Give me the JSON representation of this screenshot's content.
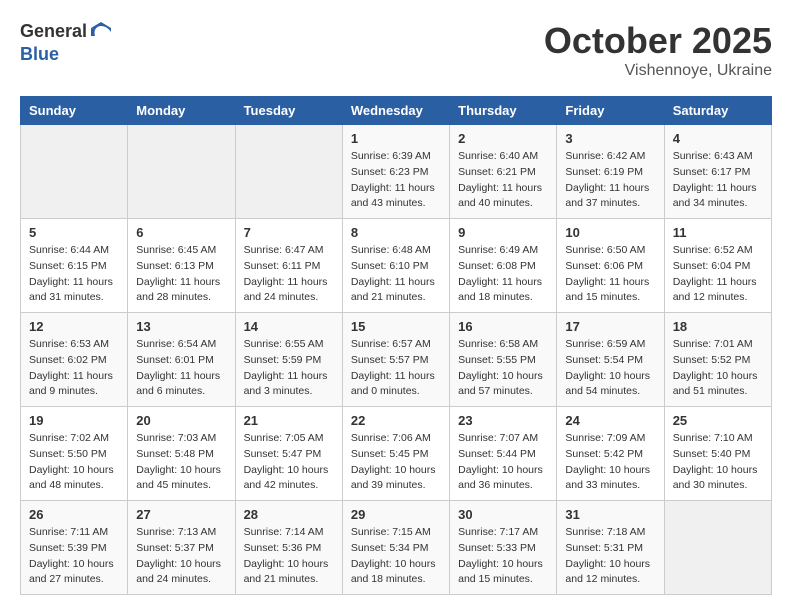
{
  "header": {
    "logo_general": "General",
    "logo_blue": "Blue",
    "month": "October 2025",
    "location": "Vishennoye, Ukraine"
  },
  "calendar": {
    "weekdays": [
      "Sunday",
      "Monday",
      "Tuesday",
      "Wednesday",
      "Thursday",
      "Friday",
      "Saturday"
    ],
    "weeks": [
      [
        {
          "day": "",
          "info": ""
        },
        {
          "day": "",
          "info": ""
        },
        {
          "day": "",
          "info": ""
        },
        {
          "day": "1",
          "info": "Sunrise: 6:39 AM\nSunset: 6:23 PM\nDaylight: 11 hours\nand 43 minutes."
        },
        {
          "day": "2",
          "info": "Sunrise: 6:40 AM\nSunset: 6:21 PM\nDaylight: 11 hours\nand 40 minutes."
        },
        {
          "day": "3",
          "info": "Sunrise: 6:42 AM\nSunset: 6:19 PM\nDaylight: 11 hours\nand 37 minutes."
        },
        {
          "day": "4",
          "info": "Sunrise: 6:43 AM\nSunset: 6:17 PM\nDaylight: 11 hours\nand 34 minutes."
        }
      ],
      [
        {
          "day": "5",
          "info": "Sunrise: 6:44 AM\nSunset: 6:15 PM\nDaylight: 11 hours\nand 31 minutes."
        },
        {
          "day": "6",
          "info": "Sunrise: 6:45 AM\nSunset: 6:13 PM\nDaylight: 11 hours\nand 28 minutes."
        },
        {
          "day": "7",
          "info": "Sunrise: 6:47 AM\nSunset: 6:11 PM\nDaylight: 11 hours\nand 24 minutes."
        },
        {
          "day": "8",
          "info": "Sunrise: 6:48 AM\nSunset: 6:10 PM\nDaylight: 11 hours\nand 21 minutes."
        },
        {
          "day": "9",
          "info": "Sunrise: 6:49 AM\nSunset: 6:08 PM\nDaylight: 11 hours\nand 18 minutes."
        },
        {
          "day": "10",
          "info": "Sunrise: 6:50 AM\nSunset: 6:06 PM\nDaylight: 11 hours\nand 15 minutes."
        },
        {
          "day": "11",
          "info": "Sunrise: 6:52 AM\nSunset: 6:04 PM\nDaylight: 11 hours\nand 12 minutes."
        }
      ],
      [
        {
          "day": "12",
          "info": "Sunrise: 6:53 AM\nSunset: 6:02 PM\nDaylight: 11 hours\nand 9 minutes."
        },
        {
          "day": "13",
          "info": "Sunrise: 6:54 AM\nSunset: 6:01 PM\nDaylight: 11 hours\nand 6 minutes."
        },
        {
          "day": "14",
          "info": "Sunrise: 6:55 AM\nSunset: 5:59 PM\nDaylight: 11 hours\nand 3 minutes."
        },
        {
          "day": "15",
          "info": "Sunrise: 6:57 AM\nSunset: 5:57 PM\nDaylight: 11 hours\nand 0 minutes."
        },
        {
          "day": "16",
          "info": "Sunrise: 6:58 AM\nSunset: 5:55 PM\nDaylight: 10 hours\nand 57 minutes."
        },
        {
          "day": "17",
          "info": "Sunrise: 6:59 AM\nSunset: 5:54 PM\nDaylight: 10 hours\nand 54 minutes."
        },
        {
          "day": "18",
          "info": "Sunrise: 7:01 AM\nSunset: 5:52 PM\nDaylight: 10 hours\nand 51 minutes."
        }
      ],
      [
        {
          "day": "19",
          "info": "Sunrise: 7:02 AM\nSunset: 5:50 PM\nDaylight: 10 hours\nand 48 minutes."
        },
        {
          "day": "20",
          "info": "Sunrise: 7:03 AM\nSunset: 5:48 PM\nDaylight: 10 hours\nand 45 minutes."
        },
        {
          "day": "21",
          "info": "Sunrise: 7:05 AM\nSunset: 5:47 PM\nDaylight: 10 hours\nand 42 minutes."
        },
        {
          "day": "22",
          "info": "Sunrise: 7:06 AM\nSunset: 5:45 PM\nDaylight: 10 hours\nand 39 minutes."
        },
        {
          "day": "23",
          "info": "Sunrise: 7:07 AM\nSunset: 5:44 PM\nDaylight: 10 hours\nand 36 minutes."
        },
        {
          "day": "24",
          "info": "Sunrise: 7:09 AM\nSunset: 5:42 PM\nDaylight: 10 hours\nand 33 minutes."
        },
        {
          "day": "25",
          "info": "Sunrise: 7:10 AM\nSunset: 5:40 PM\nDaylight: 10 hours\nand 30 minutes."
        }
      ],
      [
        {
          "day": "26",
          "info": "Sunrise: 7:11 AM\nSunset: 5:39 PM\nDaylight: 10 hours\nand 27 minutes."
        },
        {
          "day": "27",
          "info": "Sunrise: 7:13 AM\nSunset: 5:37 PM\nDaylight: 10 hours\nand 24 minutes."
        },
        {
          "day": "28",
          "info": "Sunrise: 7:14 AM\nSunset: 5:36 PM\nDaylight: 10 hours\nand 21 minutes."
        },
        {
          "day": "29",
          "info": "Sunrise: 7:15 AM\nSunset: 5:34 PM\nDaylight: 10 hours\nand 18 minutes."
        },
        {
          "day": "30",
          "info": "Sunrise: 7:17 AM\nSunset: 5:33 PM\nDaylight: 10 hours\nand 15 minutes."
        },
        {
          "day": "31",
          "info": "Sunrise: 7:18 AM\nSunset: 5:31 PM\nDaylight: 10 hours\nand 12 minutes."
        },
        {
          "day": "",
          "info": ""
        }
      ]
    ]
  }
}
